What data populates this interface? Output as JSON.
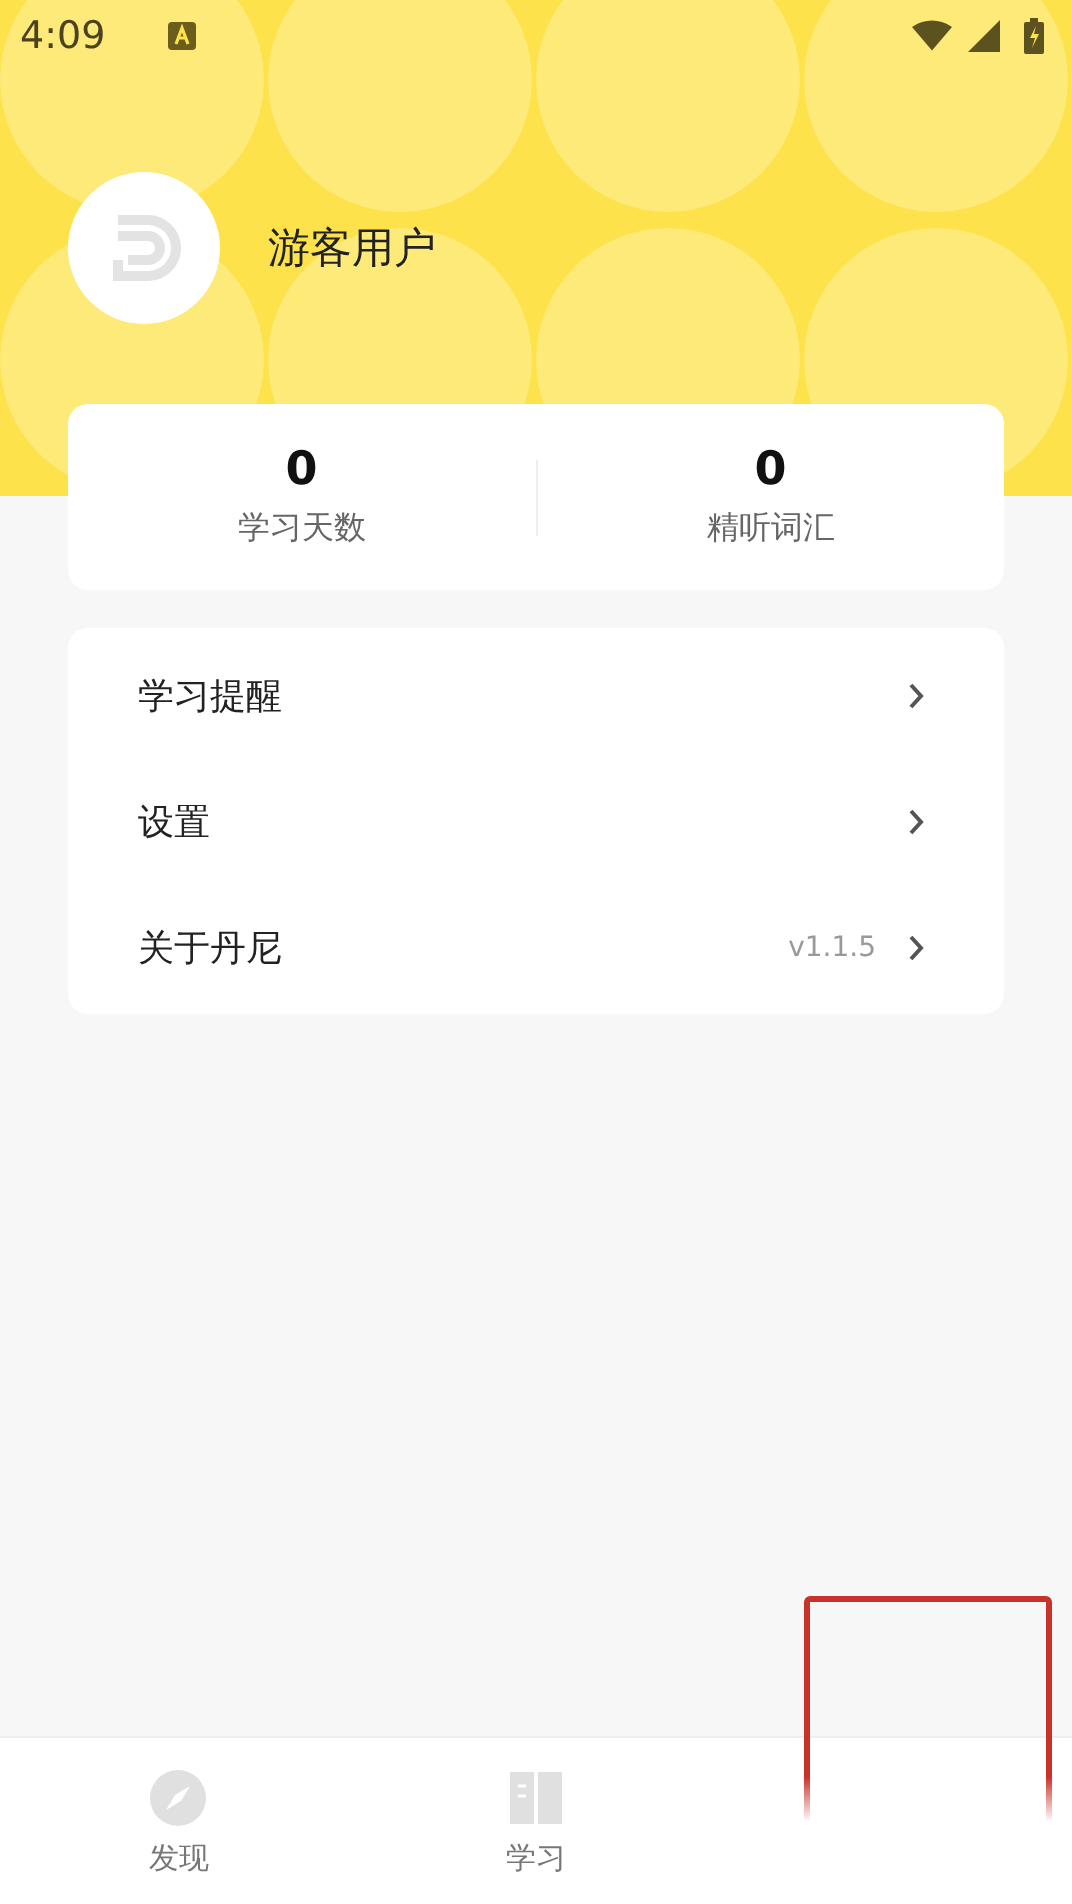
{
  "status_bar": {
    "time": "4:09"
  },
  "profile": {
    "name": "游客用户"
  },
  "stats": [
    {
      "value": "0",
      "label": "学习天数"
    },
    {
      "value": "0",
      "label": "精听词汇"
    }
  ],
  "menu": [
    {
      "label": "学习提醒"
    },
    {
      "label": "设置"
    },
    {
      "label": "关于丹尼",
      "value": "v1.1.5"
    }
  ],
  "tabs": [
    {
      "kind": "compass",
      "label": "发现",
      "selected": false
    },
    {
      "kind": "book",
      "label": "学习",
      "selected": false
    }
  ]
}
